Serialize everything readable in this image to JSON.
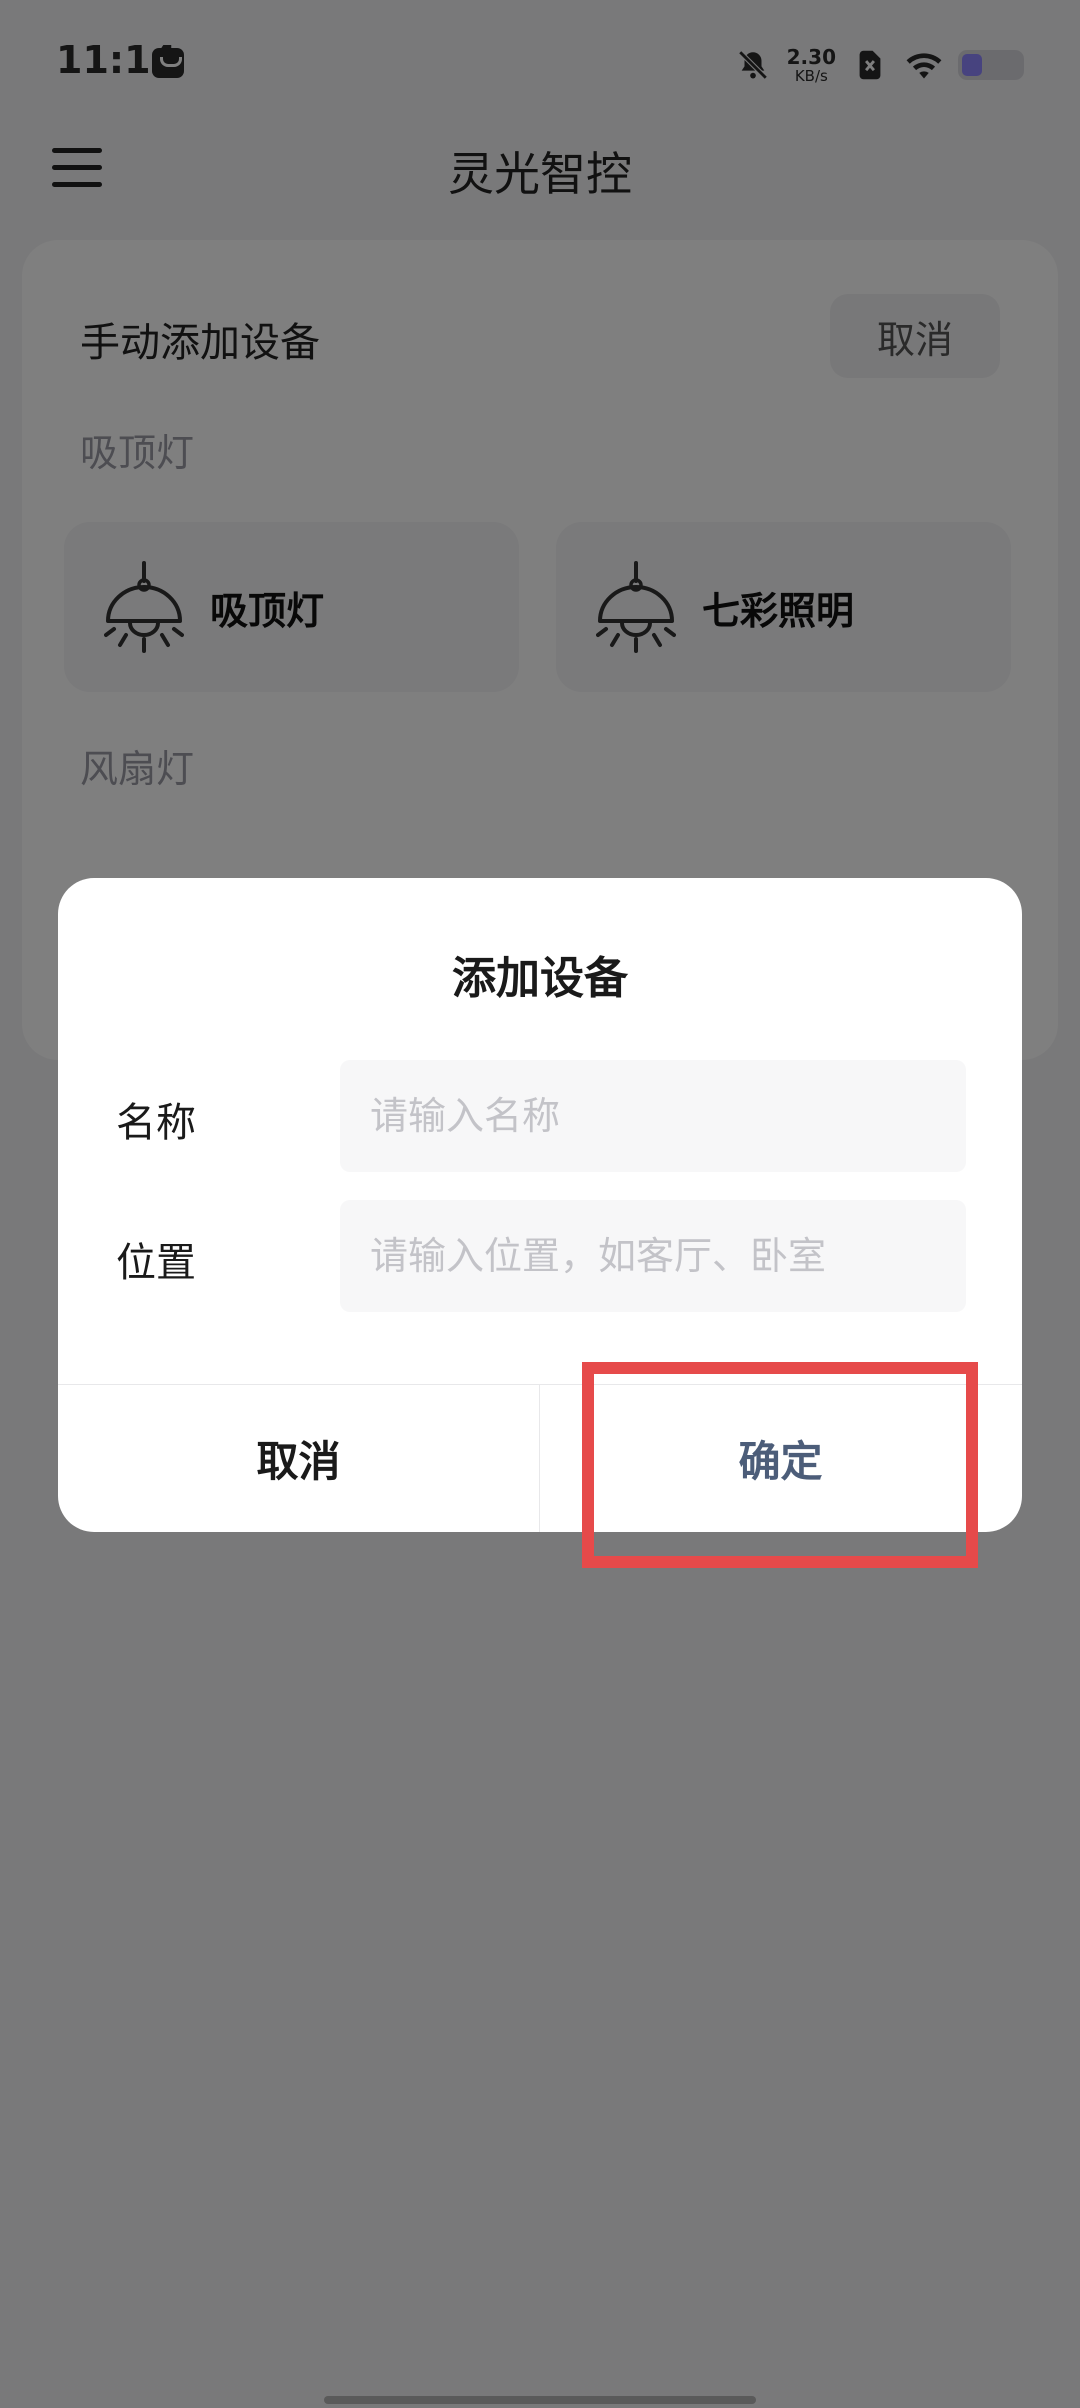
{
  "status_bar": {
    "time": "11:14",
    "net_speed_value": "2.30",
    "net_speed_unit": "KB/s",
    "battery_level": 0.3,
    "icons": [
      "app-notification-icon",
      "bell-muted-icon",
      "sim-off-icon",
      "wifi-icon",
      "battery-icon"
    ]
  },
  "header": {
    "title": "灵光智控",
    "menu_icon": "menu-icon"
  },
  "sheet": {
    "title": "手动添加设备",
    "cancel_label": "取消",
    "categories": [
      {
        "label": "吸顶灯",
        "devices": [
          {
            "name": "吸顶灯",
            "icon": "ceiling-lamp-icon"
          },
          {
            "name": "七彩照明",
            "icon": "ceiling-lamp-icon"
          }
        ]
      },
      {
        "label": "风扇灯",
        "devices": []
      }
    ]
  },
  "dialog": {
    "title": "添加设备",
    "name_label": "名称",
    "name_placeholder": "请输入名称",
    "name_value": "",
    "location_label": "位置",
    "location_placeholder": "请输入位置，如客厅、卧室",
    "location_value": "",
    "cancel_label": "取消",
    "confirm_label": "确定"
  },
  "colors": {
    "accent_confirm": "#4c5d79",
    "highlight": "#e64a4a",
    "overlay": "rgba(0,0,0,0.5)"
  }
}
